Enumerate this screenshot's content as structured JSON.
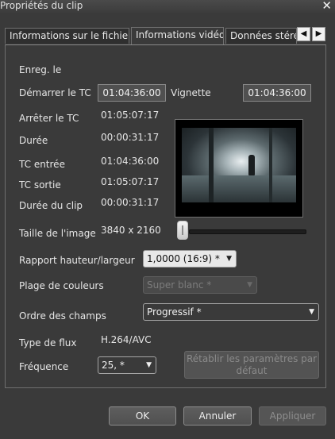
{
  "window": {
    "title": "Propriétés du clip",
    "close_icon": "close-icon"
  },
  "tabs": [
    {
      "label": "Informations sur le fichier",
      "active": false
    },
    {
      "label": "Informations vidéo",
      "active": true
    },
    {
      "label": "Données stéré",
      "active": false
    }
  ],
  "tab_nav": {
    "prev_glyph": "◀",
    "next_glyph": "▶"
  },
  "info": {
    "enreg_label": "Enreg. le",
    "demarrer_label": "Démarrer le TC",
    "demarrer_value": "01:04:36:00",
    "vignette_label": "Vignette",
    "vignette_value": "01:04:36:00",
    "arreter_label": "Arrêter le TC",
    "arreter_value": "01:05:07:17",
    "duree_label": "Durée",
    "duree_value": "00:00:31:17",
    "tc_entree_label": "TC entrée",
    "tc_entree_value": "01:04:36:00",
    "tc_sortie_label": "TC sortie",
    "tc_sortie_value": "01:05:07:17",
    "duree_clip_label": "Durée du clip",
    "duree_clip_value": "00:00:31:17",
    "taille_label": "Taille de l'image",
    "taille_value": "3840 x 2160",
    "rapport_label": "Rapport hauteur/largeur",
    "rapport_value": "1,0000 (16:9) *",
    "plage_label": "Plage de couleurs",
    "plage_value": "Super blanc *",
    "ordre_label": "Ordre des champs",
    "ordre_value": "Progressif *",
    "type_flux_label": "Type de flux",
    "type_flux_value": "H.264/AVC",
    "frequence_label": "Fréquence",
    "frequence_value": "25, *",
    "reset_label": "Rétablir les paramètres par défaut"
  },
  "footer": {
    "ok": "OK",
    "cancel": "Annuler",
    "apply": "Appliquer"
  }
}
